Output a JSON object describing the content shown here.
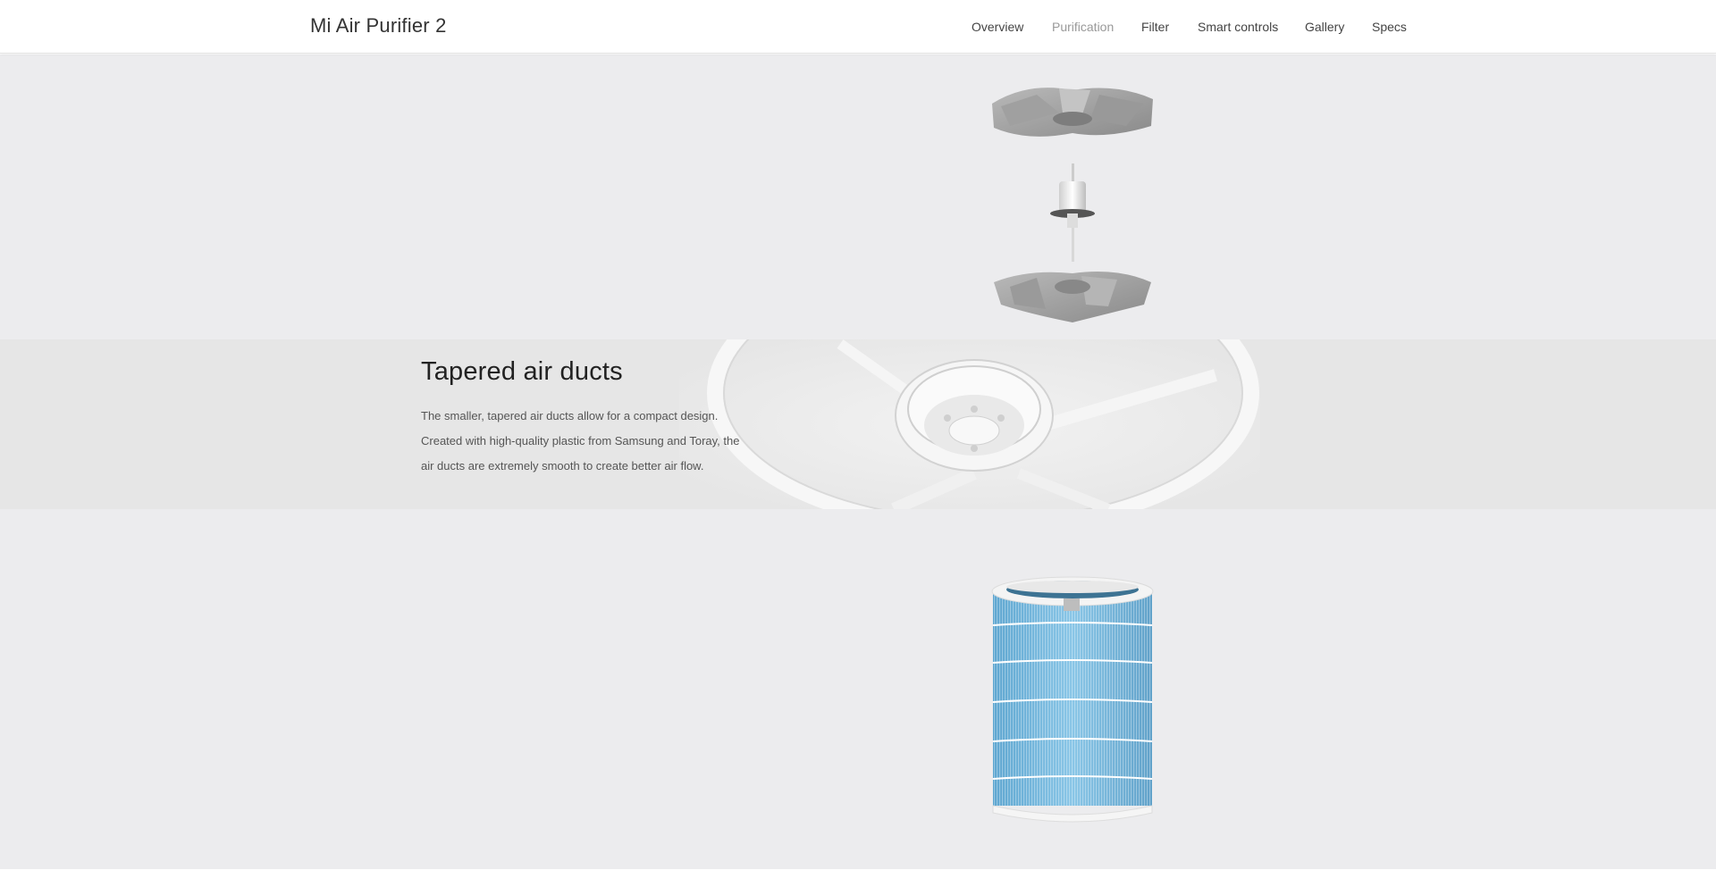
{
  "header": {
    "title": "Mi Air Purifier 2",
    "nav": [
      {
        "label": "Overview",
        "active": false
      },
      {
        "label": "Purification",
        "active": true
      },
      {
        "label": "Filter",
        "active": false
      },
      {
        "label": "Smart controls",
        "active": false
      },
      {
        "label": "Gallery",
        "active": false
      },
      {
        "label": "Specs",
        "active": false
      }
    ]
  },
  "ducts": {
    "heading": "Tapered air ducts",
    "lines": [
      "The smaller, tapered air ducts allow for a compact design.",
      "Created with high-quality plastic from Samsung and Toray, the",
      "air ducts are extremely smooth to create better air flow."
    ]
  },
  "colors": {
    "section_bg": "#ececee",
    "band_bg": "#e6e6e6",
    "filter_blue": "#6fb3d8",
    "nav_active": "#999999"
  }
}
